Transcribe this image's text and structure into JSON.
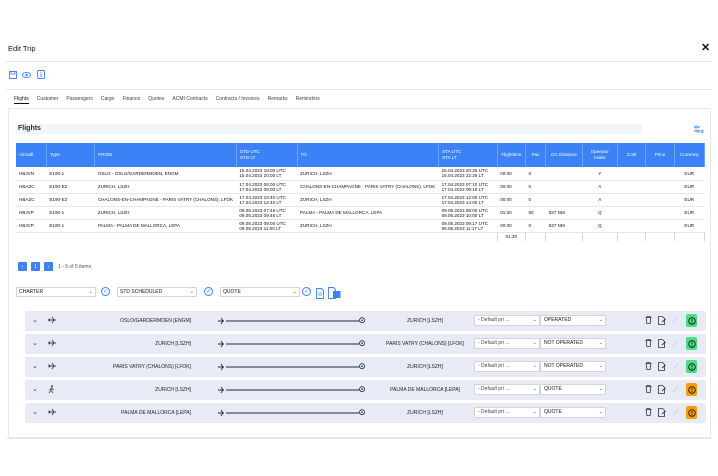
{
  "window": {
    "title": "Edit Trip"
  },
  "toolbar": {
    "icons": [
      "save-icon",
      "view-icon",
      "info-icon"
    ]
  },
  "tabs": [
    "Flights",
    "Customer",
    "Passengers",
    "Cargo",
    "Finance",
    "Quotes",
    "ACMI Contracts",
    "Contracts / Invoices",
    "Remarks",
    "Reminders"
  ],
  "section": {
    "title": "Flights"
  },
  "table": {
    "headers": [
      "Aircraft",
      "Type",
      "FROM",
      "STD UTC\nSTD LT",
      "TO",
      "STA UTC\nSTA LT",
      "Flighttime",
      "Pax",
      "GC Distance",
      "Operator Index",
      "Cost",
      "Price",
      "Currency"
    ],
    "rows": [
      [
        "HBJVN",
        "E190-1",
        "OSLO - OSLO/GARDERMOEN, ENGM",
        "15.04.2023 18:00 UTC\n15.04.2023 20:00 LT",
        "ZURICH, LSZH",
        "15.04.2023 20:25 UTC\n15.04.2023 22:25 LT",
        "00:00",
        "0",
        "",
        "Y",
        "",
        "",
        "EUR"
      ],
      [
        "HBAZC",
        "E190-E2",
        "ZURICH, LSZH",
        "17.04.2023 06:00 UTC\n17.04.2023 08:00 LT",
        "CHALONS-EN-CHAMPAGNE - PARIS VATRY (CHALONS), LFOK",
        "17.04.2023 07:10 UTC\n17.04.2023 09:10 LT",
        "00:00",
        "0",
        "",
        "A",
        "",
        "",
        "EUR"
      ],
      [
        "HBAZC",
        "E190-E2",
        "CHALONS-EN-CHAMPAGNE - PARIS VATRY (CHALONS), LFOK",
        "17.04.2023 10:40 UTC\n17.04.2023 12:40 LT",
        "ZURICH, LSZH",
        "17.04.2023 12:00 UTC\n17.04.2023 14:00 LT",
        "00:00",
        "0",
        "",
        "A",
        "",
        "",
        "EUR"
      ],
      [
        "HBJVP",
        "E190-1",
        "ZURICH, LSZH",
        "09.05.2023 07:46 UTC\n09.05.2023 09:46 LT",
        "PALMA - PALMA DE MALLORCA, LEPA",
        "09.05.2023 08:00 UTC\n09.05.2023 10:00 LT",
        "01:20",
        "50",
        "537 NM",
        "Q",
        "",
        "",
        "EUR"
      ],
      [
        "HBJVP",
        "E190-1",
        "PALMA - PALMA DE MALLORCA, LEPA",
        "09.05.2023 09:00 UTC\n09.05.2023 11:00 LT",
        "ZURICH, LSZH",
        "09.05.2023 09:17 UTC\n09.05.2023 11:17 LT",
        "00:00",
        "0",
        "537 NM",
        "Q",
        "",
        "",
        "EUR"
      ]
    ],
    "total_flighttime": "01:20"
  },
  "pager": {
    "current": "1",
    "info": "1 - 5 of 5 items"
  },
  "controls": {
    "charter": "CHARTER",
    "std": "STD SCHEDULED",
    "quote": "QUOTE"
  },
  "legs": [
    {
      "from": "OSLO/GARDERMOEN  [ENGM]",
      "to": "ZURICH  [LSZH]",
      "pricelist": "- Default pri ...",
      "status": "OPERATED",
      "badge": "green",
      "aircraft_icon": "plane-icon"
    },
    {
      "from": "ZURICH  [LSZH]",
      "to": "PARIS VATRY (CHALONS)  [LFOK]",
      "pricelist": "- Default pri ...",
      "status": "NOT OPERATED",
      "badge": "green",
      "aircraft_icon": "plane-icon"
    },
    {
      "from": "PARIS VATRY (CHALONS)  [LFOK]",
      "to": "ZURICH  [LSZH]",
      "pricelist": "- Default pri ...",
      "status": "NOT OPERATED",
      "badge": "green",
      "aircraft_icon": "plane-icon"
    },
    {
      "from": "ZURICH  [LSZH]",
      "to": "PALMA DE MALLORCA  [LEPA]",
      "pricelist": "- Default pri ...",
      "status": "QUOTE",
      "badge": "orange",
      "aircraft_icon": "walking-icon"
    },
    {
      "from": "PALMA DE MALLORCA  [LEPA]",
      "to": "ZURICH  [LSZH]",
      "pricelist": "- Default pri ...",
      "status": "QUOTE",
      "badge": "orange",
      "aircraft_icon": "plane-icon"
    }
  ],
  "colors": {
    "accent": "#3b82f6",
    "leg_bg": "#e8ebf6",
    "badge_green": "#4ade80",
    "badge_orange": "#f59e0b"
  }
}
